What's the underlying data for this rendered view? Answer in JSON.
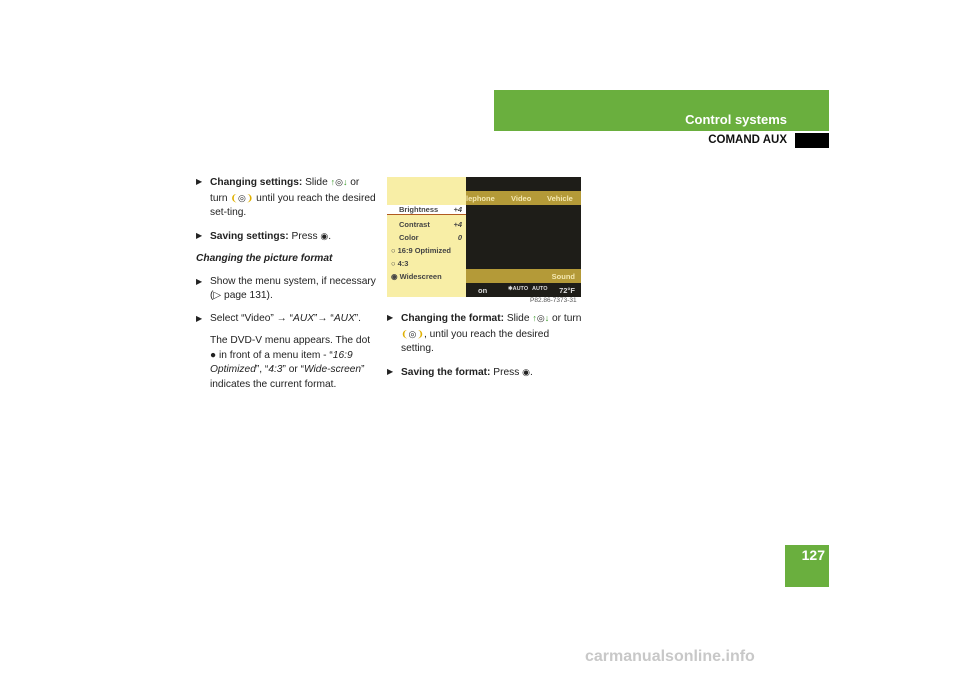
{
  "header": {
    "section": "Control systems",
    "subsection": "COMAND AUX",
    "page_number": "127",
    "accent": "#6aaf3e"
  },
  "left": {
    "item1": {
      "bold": "Changing settings:",
      "text1": " Slide ",
      "text2": " or turn ",
      "text3": " until you reach the desired set-ting."
    },
    "item2": {
      "bold": "Saving settings:",
      "text": " Press ",
      "end": "."
    },
    "heading": "Changing the picture format",
    "item3": {
      "text": "Show the menu system, if necessary (▷ page 131)."
    },
    "item4": {
      "text1": "Select “Video” → “",
      "aux1": "AUX",
      "text2": "”→ “",
      "aux2": "AUX",
      "text3": "”."
    },
    "note": {
      "t1": "The DVD-V menu appears. The dot ● in front of a menu item - “",
      "i1": "16:9 Optimized",
      "t2": "”, “",
      "i2": "4:3",
      "t3": "” or “",
      "i3": "Wide-screen",
      "t4": "” indicates the current format."
    }
  },
  "screen": {
    "menu": [
      {
        "label": "Brightness",
        "value": "+4"
      },
      {
        "label": "Contrast",
        "value": "+4"
      },
      {
        "label": "Color",
        "value": "0"
      }
    ],
    "formats": [
      {
        "label": "○ 16:9 Optimized"
      },
      {
        "label": "○ 4:3"
      },
      {
        "label": "◉ Widescreen"
      }
    ],
    "top_bar": [
      "lephone",
      "Video",
      "Vehicle"
    ],
    "bottom_bar": "Sound",
    "status": [
      "on",
      "✱AUTO",
      "AUTO",
      "72°F"
    ],
    "ref": "P82.86-7373-31"
  },
  "right": {
    "item1": {
      "bold": "Changing the format:",
      "text1": " Slide ",
      "text2": " or turn ",
      "text3": ", until you reach the desired setting."
    },
    "item2": {
      "bold": "Saving the format:",
      "text": " Press ",
      "end": "."
    }
  },
  "icons": {
    "slide": "slide-controller-icon",
    "turn": "turn-controller-icon",
    "press": "press-controller-icon"
  },
  "watermark": "carmanualsonline.info"
}
